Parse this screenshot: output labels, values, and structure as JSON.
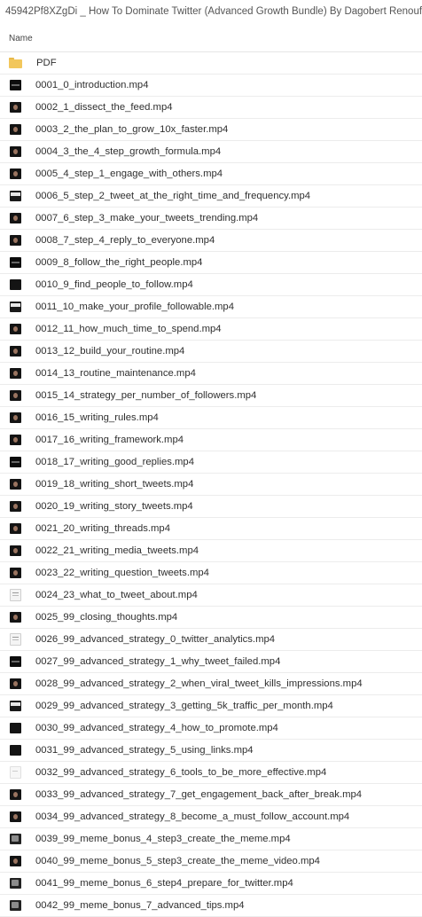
{
  "window": {
    "title": "45942Pf8XZgDi _ How To Dominate Twitter (Advanced Growth Bundle) By Dagobert Renouf"
  },
  "header": {
    "name_column": "Name"
  },
  "files": [
    {
      "name": "PDF",
      "icon": "folder-icon"
    },
    {
      "name": "0001_0_introduction.mp4",
      "icon": "video-thumbnail-dark"
    },
    {
      "name": "0002_1_dissect_the_feed.mp4",
      "icon": "video-thumbnail-face"
    },
    {
      "name": "0003_2_the_plan_to_grow_10x_faster.mp4",
      "icon": "video-thumbnail-face"
    },
    {
      "name": "0004_3_the_4_step_growth_formula.mp4",
      "icon": "video-thumbnail-face"
    },
    {
      "name": "0005_4_step_1_engage_with_others.mp4",
      "icon": "video-thumbnail-face"
    },
    {
      "name": "0006_5_step_2_tweet_at_the_right_time_and_frequency.mp4",
      "icon": "video-thumbnail-screen"
    },
    {
      "name": "0007_6_step_3_make_your_tweets_trending.mp4",
      "icon": "video-thumbnail-face"
    },
    {
      "name": "0008_7_step_4_reply_to_everyone.mp4",
      "icon": "video-thumbnail-face"
    },
    {
      "name": "0009_8_follow_the_right_people.mp4",
      "icon": "video-thumbnail-dark"
    },
    {
      "name": "0010_9_find_people_to_follow.mp4",
      "icon": "video-thumbnail-black"
    },
    {
      "name": "0011_10_make_your_profile_followable.mp4",
      "icon": "video-thumbnail-screen"
    },
    {
      "name": "0012_11_how_much_time_to_spend.mp4",
      "icon": "video-thumbnail-face"
    },
    {
      "name": "0013_12_build_your_routine.mp4",
      "icon": "video-thumbnail-face"
    },
    {
      "name": "0014_13_routine_maintenance.mp4",
      "icon": "video-thumbnail-face"
    },
    {
      "name": "0015_14_strategy_per_number_of_followers.mp4",
      "icon": "video-thumbnail-face"
    },
    {
      "name": "0016_15_writing_rules.mp4",
      "icon": "video-thumbnail-face"
    },
    {
      "name": "0017_16_writing_framework.mp4",
      "icon": "video-thumbnail-face"
    },
    {
      "name": "0018_17_writing_good_replies.mp4",
      "icon": "video-thumbnail-dark"
    },
    {
      "name": "0019_18_writing_short_tweets.mp4",
      "icon": "video-thumbnail-face"
    },
    {
      "name": "0020_19_writing_story_tweets.mp4",
      "icon": "video-thumbnail-face"
    },
    {
      "name": "0021_20_writing_threads.mp4",
      "icon": "video-thumbnail-face"
    },
    {
      "name": "0022_21_writing_media_tweets.mp4",
      "icon": "video-thumbnail-face"
    },
    {
      "name": "0023_22_writing_question_tweets.mp4",
      "icon": "video-thumbnail-face"
    },
    {
      "name": "0024_23_what_to_tweet_about.mp4",
      "icon": "video-thumbnail-light"
    },
    {
      "name": "0025_99_closing_thoughts.mp4",
      "icon": "video-thumbnail-face"
    },
    {
      "name": "0026_99_advanced_strategy_0_twitter_analytics.mp4",
      "icon": "video-thumbnail-light"
    },
    {
      "name": "0027_99_advanced_strategy_1_why_tweet_failed.mp4",
      "icon": "video-thumbnail-dark"
    },
    {
      "name": "0028_99_advanced_strategy_2_when_viral_tweet_kills_impressions.mp4",
      "icon": "video-thumbnail-face"
    },
    {
      "name": "0029_99_advanced_strategy_3_getting_5k_traffic_per_month.mp4",
      "icon": "video-thumbnail-screen"
    },
    {
      "name": "0030_99_advanced_strategy_4_how_to_promote.mp4",
      "icon": "video-thumbnail-black"
    },
    {
      "name": "0031_99_advanced_strategy_5_using_links.mp4",
      "icon": "video-thumbnail-black"
    },
    {
      "name": "0032_99_advanced_strategy_6_tools_to_be_more_effective.mp4",
      "icon": "video-thumbnail-faint"
    },
    {
      "name": "0033_99_advanced_strategy_7_get_engagement_back_after_break.mp4",
      "icon": "video-thumbnail-face"
    },
    {
      "name": "0034_99_advanced_strategy_8_become_a_must_follow_account.mp4",
      "icon": "video-thumbnail-face"
    },
    {
      "name": "0039_99_meme_bonus_4_step3_create_the_meme.mp4",
      "icon": "video-thumbnail-meme"
    },
    {
      "name": "0040_99_meme_bonus_5_step3_create_the_meme_video.mp4",
      "icon": "video-thumbnail-face"
    },
    {
      "name": "0041_99_meme_bonus_6_step4_prepare_for_twitter.mp4",
      "icon": "video-thumbnail-meme"
    },
    {
      "name": "0042_99_meme_bonus_7_advanced_tips.mp4",
      "icon": "video-thumbnail-meme"
    }
  ]
}
